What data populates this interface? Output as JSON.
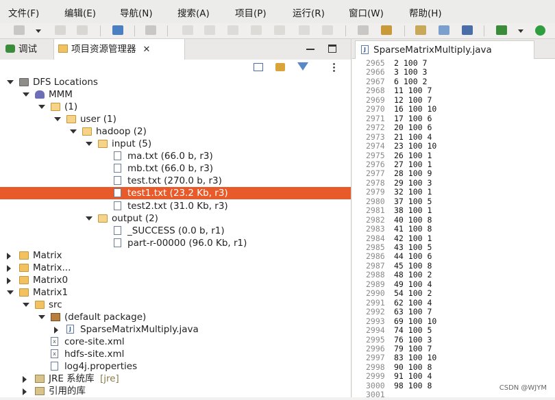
{
  "menu": [
    "文件(F)",
    "编辑(E)",
    "导航(N)",
    "搜索(A)",
    "项目(P)",
    "运行(R)",
    "窗口(W)",
    "帮助(H)"
  ],
  "left_tabs": {
    "debug": "调试",
    "project_explorer": "项目资源管理器",
    "close": "✕"
  },
  "tree": [
    {
      "label": "DFS Locations",
      "arrow": "down",
      "icon": "dfs-icon",
      "indent": 0
    },
    {
      "label": "MMM",
      "arrow": "down",
      "icon": "elephant-icon",
      "indent": 1
    },
    {
      "label": "(1)",
      "arrow": "down",
      "icon": "folder-open-icon",
      "indent": 2
    },
    {
      "label": "user (1)",
      "arrow": "down",
      "icon": "folder-open-icon",
      "indent": 3
    },
    {
      "label": "hadoop (2)",
      "arrow": "down",
      "icon": "folder-open-icon",
      "indent": 4
    },
    {
      "label": "input (5)",
      "arrow": "down",
      "icon": "folder-open-icon",
      "indent": 5
    },
    {
      "label": "ma.txt (66.0 b, r3)",
      "arrow": "",
      "icon": "file-icon",
      "indent": 6
    },
    {
      "label": "mb.txt (66.0 b, r3)",
      "arrow": "",
      "icon": "file-icon",
      "indent": 6
    },
    {
      "label": "test.txt (270.0 b, r3)",
      "arrow": "",
      "icon": "file-icon",
      "indent": 6
    },
    {
      "label": "test1.txt (23.2 Kb, r3)",
      "arrow": "",
      "icon": "file-icon",
      "indent": 6,
      "selected": true
    },
    {
      "label": "test2.txt (31.0 Kb, r3)",
      "arrow": "",
      "icon": "file-icon",
      "indent": 6
    },
    {
      "label": "output (2)",
      "arrow": "down",
      "icon": "folder-open-icon",
      "indent": 5
    },
    {
      "label": "_SUCCESS (0.0 b, r1)",
      "arrow": "",
      "icon": "file-icon",
      "indent": 6
    },
    {
      "label": "part-r-00000 (96.0 Kb, r1)",
      "arrow": "",
      "icon": "file-icon",
      "indent": 6
    },
    {
      "label": "Matrix",
      "arrow": "right",
      "icon": "project-icon",
      "indent": 0
    },
    {
      "label": "Matrix...",
      "arrow": "right",
      "icon": "project-icon",
      "indent": 0
    },
    {
      "label": "Matrix0",
      "arrow": "right",
      "icon": "project-icon",
      "indent": 0
    },
    {
      "label": "Matrix1",
      "arrow": "down",
      "icon": "project-icon",
      "indent": 0
    },
    {
      "label": "src",
      "arrow": "down",
      "icon": "src-folder-icon",
      "indent": 1
    },
    {
      "label": "(default package)",
      "arrow": "down",
      "icon": "package-icon",
      "indent": 2
    },
    {
      "label": "SparseMatrixMultiply.java",
      "arrow": "right",
      "icon": "java-file-icon",
      "indent": 3
    },
    {
      "label": "core-site.xml",
      "arrow": "",
      "icon": "xml-file-icon",
      "indent": 2
    },
    {
      "label": "hdfs-site.xml",
      "arrow": "",
      "icon": "xml-file-icon",
      "indent": 2
    },
    {
      "label": "log4j.properties",
      "arrow": "",
      "icon": "file-icon",
      "indent": 2
    },
    {
      "label": "JRE 系统库",
      "suffix": "[jre]",
      "arrow": "right",
      "icon": "library-icon",
      "indent": 1
    },
    {
      "label": "引用的库",
      "arrow": "right",
      "icon": "library-icon",
      "indent": 1
    }
  ],
  "editor": {
    "tab_title": "SparseMatrixMultiply.java",
    "lines": [
      [
        "2965",
        "2 100 7"
      ],
      [
        "2966",
        "3 100 3"
      ],
      [
        "2967",
        "6 100 2"
      ],
      [
        "2968",
        "11 100 7"
      ],
      [
        "2969",
        "12 100 7"
      ],
      [
        "2970",
        "16 100 10"
      ],
      [
        "2971",
        "17 100 6"
      ],
      [
        "2972",
        "20 100 6"
      ],
      [
        "2973",
        "21 100 4"
      ],
      [
        "2974",
        "23 100 10"
      ],
      [
        "2975",
        "26 100 1"
      ],
      [
        "2976",
        "27 100 1"
      ],
      [
        "2977",
        "28 100 9"
      ],
      [
        "2978",
        "29 100 3"
      ],
      [
        "2979",
        "32 100 1"
      ],
      [
        "2980",
        "37 100 5"
      ],
      [
        "2981",
        "38 100 1"
      ],
      [
        "2982",
        "40 100 8"
      ],
      [
        "2983",
        "41 100 8"
      ],
      [
        "2984",
        "42 100 1"
      ],
      [
        "2985",
        "43 100 5"
      ],
      [
        "2986",
        "44 100 6"
      ],
      [
        "2987",
        "45 100 8"
      ],
      [
        "2988",
        "48 100 2"
      ],
      [
        "2989",
        "49 100 4"
      ],
      [
        "2990",
        "54 100 2"
      ],
      [
        "2991",
        "62 100 4"
      ],
      [
        "2992",
        "63 100 7"
      ],
      [
        "2993",
        "69 100 10"
      ],
      [
        "2994",
        "74 100 5"
      ],
      [
        "2995",
        "76 100 3"
      ],
      [
        "2996",
        "79 100 7"
      ],
      [
        "2997",
        "83 100 10"
      ],
      [
        "2998",
        "90 100 8"
      ],
      [
        "2999",
        "91 100 4"
      ],
      [
        "3000",
        "98 100 8"
      ],
      [
        "3001",
        ""
      ]
    ]
  },
  "watermark": "CSDN @WJYM",
  "colors": {
    "selection": "#e95a2a",
    "run": "#2f9e3f"
  }
}
